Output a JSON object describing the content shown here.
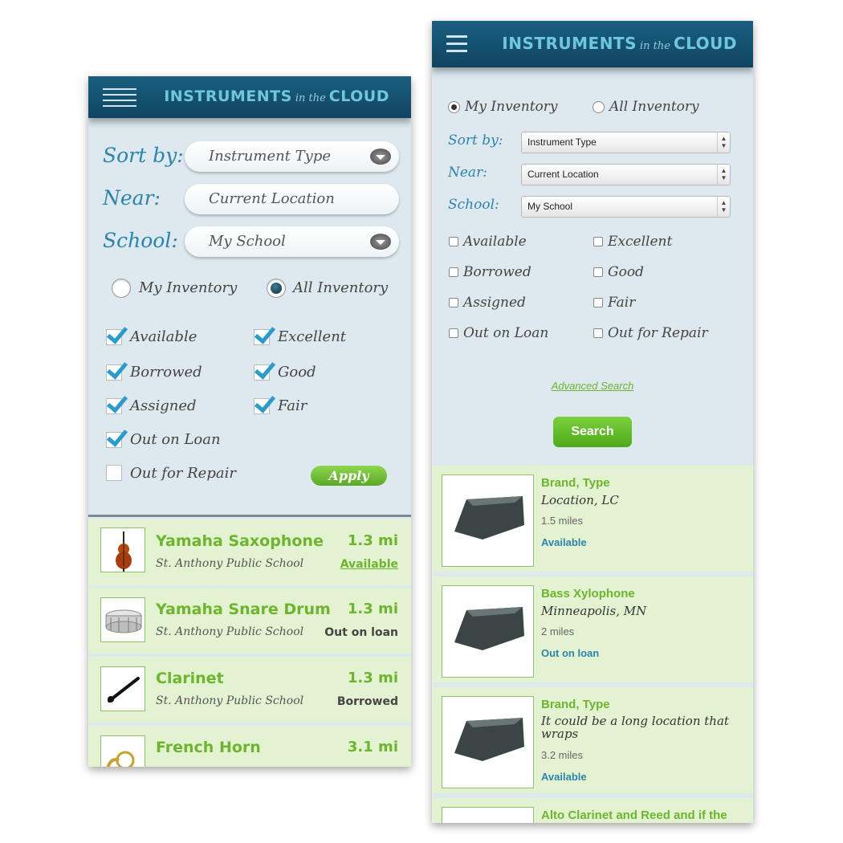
{
  "app": {
    "title_left": "INSTRUMENTS",
    "title_mid": "in the",
    "title_right": "CLOUD"
  },
  "left": {
    "sort_label": "Sort by:",
    "sort_value": "Instrument Type",
    "near_label": "Near:",
    "near_value": "Current Location",
    "school_label": "School:",
    "school_value": "My School",
    "scope": {
      "my": "My Inventory",
      "all": "All Inventory",
      "selected": "All Inventory"
    },
    "filters": [
      {
        "label": "Available",
        "checked": true
      },
      {
        "label": "Borrowed",
        "checked": true
      },
      {
        "label": "Assigned",
        "checked": true
      },
      {
        "label": "Out on Loan",
        "checked": true
      },
      {
        "label": "Out for Repair",
        "checked": false
      },
      {
        "label": "Excellent",
        "checked": true
      },
      {
        "label": "Good",
        "checked": true
      },
      {
        "label": "Fair",
        "checked": true
      }
    ],
    "apply_label": "Apply",
    "results": [
      {
        "name": "Yamaha Saxophone",
        "school": "St. Anthony Public School",
        "distance": "1.3 mi",
        "status": "Available",
        "icon": "cello-icon"
      },
      {
        "name": "Yamaha Snare Drum",
        "school": "St. Anthony Public School",
        "distance": "1.3 mi",
        "status": "Out on loan",
        "icon": "snare-drum-icon"
      },
      {
        "name": "Clarinet",
        "school": "St. Anthony Public School",
        "distance": "1.3 mi",
        "status": "Borrowed",
        "icon": "clarinet-icon"
      },
      {
        "name": "French Horn",
        "school": "",
        "distance": "3.1 mi",
        "status": "",
        "icon": "french-horn-icon"
      }
    ]
  },
  "right": {
    "scope": {
      "my": "My Inventory",
      "all": "All Inventory",
      "selected": "My Inventory"
    },
    "sort_label": "Sort by:",
    "sort_value": "Instrument Type",
    "near_label": "Near:",
    "near_value": "Current Location",
    "school_label": "School:",
    "school_value": "My School",
    "filters": [
      {
        "label": "Available",
        "checked": false
      },
      {
        "label": "Borrowed",
        "checked": false
      },
      {
        "label": "Assigned",
        "checked": false
      },
      {
        "label": "Out on Loan",
        "checked": false
      },
      {
        "label": "Excellent",
        "checked": false
      },
      {
        "label": "Good",
        "checked": false
      },
      {
        "label": "Fair",
        "checked": false
      },
      {
        "label": "Out for Repair",
        "checked": false
      }
    ],
    "advanced_link": "Advanced Search",
    "search_label": "Search",
    "results": [
      {
        "title": "Brand, Type",
        "location": "Location, LC",
        "distance": "1.5 miles",
        "status": "Available",
        "icon": "cowbell-icon"
      },
      {
        "title": "Bass Xylophone",
        "location": "Minneapolis, MN",
        "distance": "2 miles",
        "status": "Out on loan",
        "icon": "cowbell-icon"
      },
      {
        "title": "Brand, Type",
        "location": "It could be a long location that wraps",
        "distance": "3.2 miles",
        "status": "Available",
        "icon": "cowbell-icon"
      },
      {
        "title": "Alto Clarinet and Reed and if the",
        "location": "",
        "distance": "",
        "status": "",
        "icon": "cowbell-icon"
      }
    ]
  },
  "colors": {
    "header": "#1b5f80",
    "brand": "#6fc7df",
    "accent_green": "#6cb52d",
    "panel": "#dde9ef",
    "row": "#e3f3d2",
    "link_blue": "#2a84ad"
  }
}
